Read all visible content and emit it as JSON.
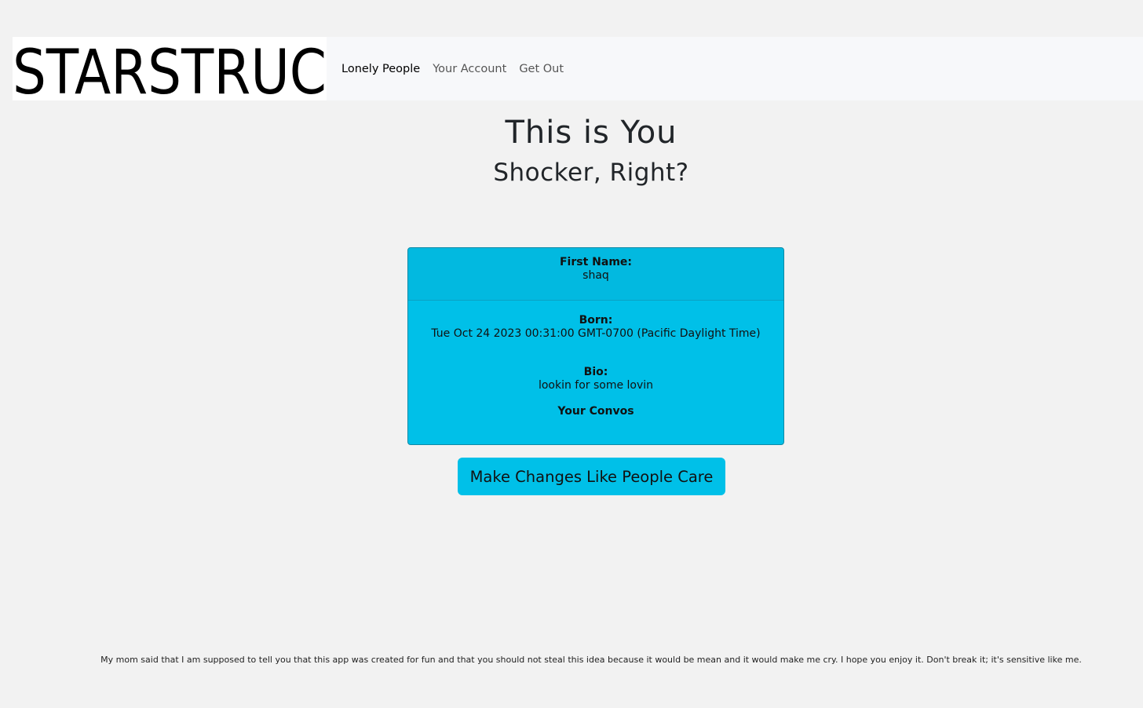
{
  "brand": {
    "logo_text": "STARSTRUC"
  },
  "nav": {
    "items": [
      {
        "label": "Lonely People",
        "active": true
      },
      {
        "label": "Your Account",
        "active": false
      },
      {
        "label": "Get Out",
        "active": false
      }
    ]
  },
  "page": {
    "title": "This is You",
    "subtitle": "Shocker, Right?"
  },
  "profile": {
    "first_name_label": "First Name:",
    "first_name": "shaq",
    "born_label": "Born:",
    "born": "Tue Oct 24 2023 00:31:00 GMT-0700 (Pacific Daylight Time)",
    "bio_label": "Bio:",
    "bio": "lookin for some lovin",
    "convos_label": "Your Convos"
  },
  "actions": {
    "edit_label": "Make Changes Like People Care"
  },
  "footer": {
    "text": "My mom said that I am supposed to tell you that this app was created for fun and that you should not steal this idea because it would be mean and it would make me cry. I hope you enjoy it. Don't break it; it's sensitive like me."
  },
  "colors": {
    "accent": "#00c0e8",
    "page_background": "#f2f2f2",
    "navbar_background": "#f7f8fa"
  }
}
